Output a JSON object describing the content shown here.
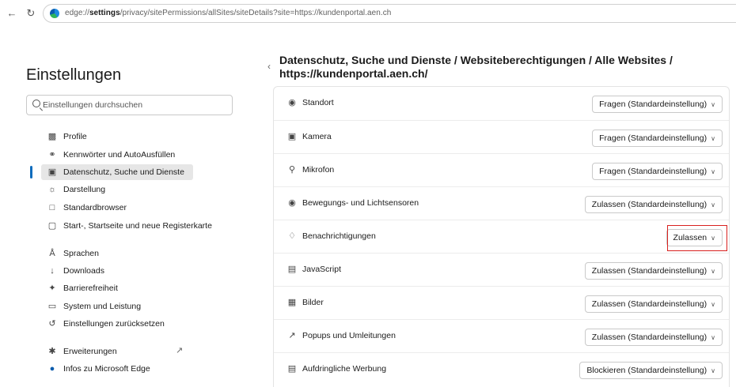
{
  "browser": {
    "url_prefix": "edge://",
    "url_bold": "settings",
    "url_rest": "/privacy/sitePermissions/allSites/siteDetails?site=https://kundenportal.aen.ch"
  },
  "sidebar": {
    "title": "Einstellungen",
    "search_placeholder": "Einstellungen durchsuchen",
    "items": [
      {
        "label": "Profile",
        "icon": "profile-icon"
      },
      {
        "label": "Kennwörter und AutoAusfüllen",
        "icon": "key-icon"
      },
      {
        "label": "Datenschutz, Suche und Dienste",
        "icon": "lock-icon",
        "active": true
      },
      {
        "label": "Darstellung",
        "icon": "palette-icon"
      },
      {
        "label": "Standardbrowser",
        "icon": "browser-icon"
      },
      {
        "label": "Start-, Startseite und neue Registerkarte",
        "icon": "home-tab-icon"
      },
      {
        "label": "Sprachen",
        "icon": "language-icon"
      },
      {
        "label": "Downloads",
        "icon": "download-icon"
      },
      {
        "label": "Barrierefreiheit",
        "icon": "accessibility-icon"
      },
      {
        "label": "System und Leistung",
        "icon": "laptop-icon"
      },
      {
        "label": "Einstellungen zurücksetzen",
        "icon": "reset-icon"
      },
      {
        "label": "Erweiterungen",
        "icon": "extensions-icon"
      },
      {
        "label": "Infos zu Microsoft Edge",
        "icon": "edge-icon"
      }
    ]
  },
  "main": {
    "breadcrumb_line1": "Datenschutz, Suche und Dienste / Websiteberechtigungen / Alle Websites /",
    "breadcrumb_line2": "https://kundenportal.aen.ch/",
    "permissions": [
      {
        "label": "Standort",
        "icon": "location-icon",
        "value": "Fragen (Standardeinstellung)"
      },
      {
        "label": "Kamera",
        "icon": "camera-icon",
        "value": "Fragen (Standardeinstellung)"
      },
      {
        "label": "Mikrofon",
        "icon": "microphone-icon",
        "value": "Fragen (Standardeinstellung)"
      },
      {
        "label": "Bewegungs- und Lichtsensoren",
        "icon": "sensor-icon",
        "value": "Zulassen (Standardeinstellung)"
      },
      {
        "label": "Benachrichtigungen",
        "icon": "bell-icon",
        "value": "Zulassen"
      },
      {
        "label": "JavaScript",
        "icon": "javascript-icon",
        "value": "Zulassen (Standardeinstellung)"
      },
      {
        "label": "Bilder",
        "icon": "image-icon",
        "value": "Zulassen (Standardeinstellung)"
      },
      {
        "label": "Popups und Umleitungen",
        "icon": "popup-icon",
        "value": "Zulassen (Standardeinstellung)"
      },
      {
        "label": "Aufdringliche Werbung",
        "icon": "ad-icon",
        "value": "Blockieren (Standardeinstellung)"
      }
    ]
  },
  "colors": {
    "accent": "#0f6cbd",
    "highlight": "#d9211f"
  }
}
